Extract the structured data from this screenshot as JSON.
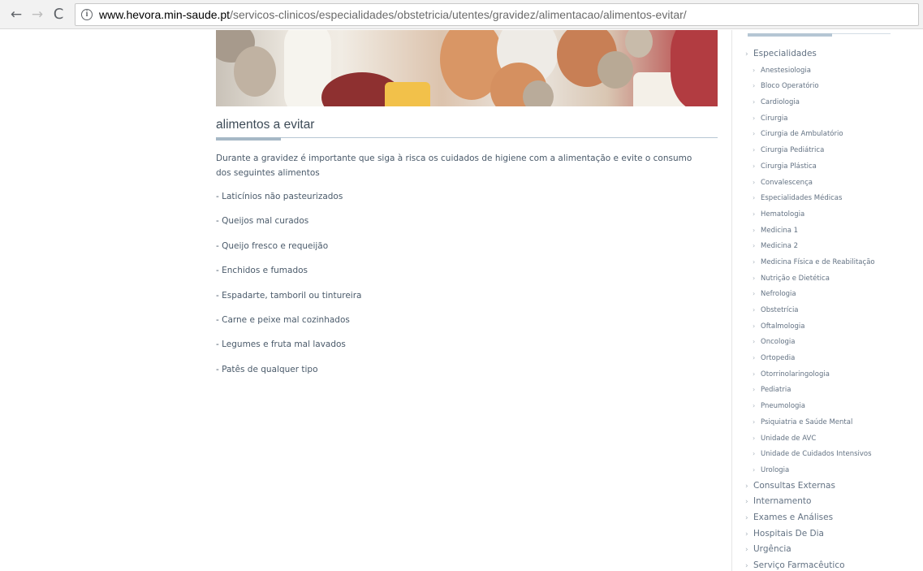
{
  "browser": {
    "url_host": "www.hevora.min-saude.pt",
    "url_path": "/servicos-clinicos/especialidades/obstetricia/utentes/gravidez/alimentacao/alimentos-evitar/"
  },
  "icons": {
    "back": "←",
    "forward": "→",
    "reload": "C",
    "info": "i",
    "chevron": "›"
  },
  "content": {
    "title": "alimentos a evitar",
    "intro": "Durante a gravidez é importante que siga à risca os cuidados de higiene com a alimentação e evite o consumo dos seguintes alimentos",
    "items": [
      "- Laticínios não pasteurizados",
      "- Queijos mal curados",
      " - Queijo fresco e requeijão",
      " - Enchidos e fumados",
      "- Espadarte, tamboril ou tintureira",
      " - Carne e peixe mal cozinhados",
      " - Legumes e fruta mal lavados",
      " - Patês de qualquer tipo"
    ]
  },
  "sidebar": {
    "top": "Especialidades",
    "specialties": [
      "Anestesiologia",
      "Bloco Operatório",
      "Cardiologia",
      "Cirurgia",
      "Cirurgia de Ambulatório",
      "Cirurgia Pediátrica",
      "Cirurgia Plástica",
      "Convalescença",
      "Especialidades Médicas",
      "Hematologia",
      "Medicina 1",
      "Medicina 2",
      "Medicina Física e de Reabilitação",
      "Nutrição e Dietética",
      "Nefrologia",
      "Obstetrícia",
      "Oftalmologia",
      "Oncologia",
      "Ortopedia",
      "Otorrinolaringologia",
      "Pediatria",
      "Pneumologia",
      "Psiquiatria e Saúde Mental",
      "Unidade de AVC",
      "Unidade de Cuidados Intensivos",
      "Urologia"
    ],
    "sections": [
      "Consultas Externas",
      "Internamento",
      "Exames e Análises",
      "Hospitais De Dia",
      "Urgência",
      "Serviço Farmacêutico"
    ]
  }
}
